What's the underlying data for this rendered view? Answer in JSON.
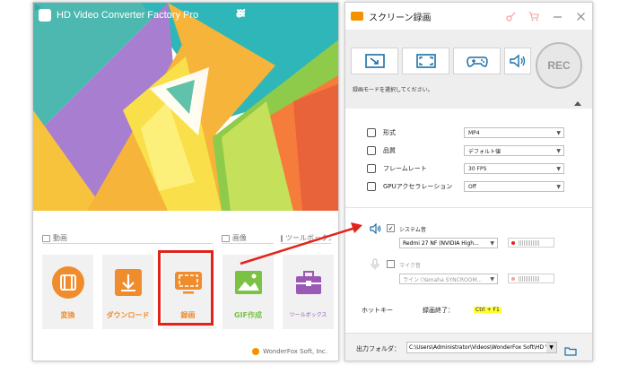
{
  "left_window": {
    "title": "HD Video Converter Factory Pro",
    "sections": {
      "video": "動画",
      "image": "画像",
      "toolbox": "ツールボックス"
    },
    "tools": [
      {
        "label": "変換",
        "color": "#f08c2c"
      },
      {
        "label": "ダウンロード",
        "color": "#f08c2c"
      },
      {
        "label": "録画",
        "color": "#f08c2c"
      },
      {
        "label": "GIF作成",
        "color": "#7bc144"
      },
      {
        "label": "ツールボックス",
        "color": "#9b59b6"
      }
    ],
    "footer": "WonderFox Soft, Inc."
  },
  "right_window": {
    "title": "スクリーン録画",
    "rec_button": "REC",
    "mode_hint": "録画モードを選択してください。",
    "settings": [
      {
        "label": "形式",
        "value": "MP4"
      },
      {
        "label": "品質",
        "value": "デフォルト値"
      },
      {
        "label": "フレームレート",
        "value": "30 FPS"
      },
      {
        "label": "GPUアクセラレーション",
        "value": "Off"
      }
    ],
    "system_audio": {
      "label": "システム音",
      "checked": "✓",
      "device": "Redmi 27 NF (NVIDIA High..."
    },
    "mic_audio": {
      "label": "マイク音",
      "device": "ライン (Yamaha SYNCROOM..."
    },
    "hotkey": {
      "label": "ホットキー",
      "stop_label": "録画終了：",
      "stop_value": "Ctrl + F1"
    },
    "output": {
      "label": "出力フォルダ：",
      "path": "C:\\Users\\Administrator\\Videos\\WonderFox Soft\\HD V"
    }
  },
  "colors": {
    "highlight": "#e2231a",
    "accent_orange": "#f39200",
    "arrow": "#e2231a"
  }
}
